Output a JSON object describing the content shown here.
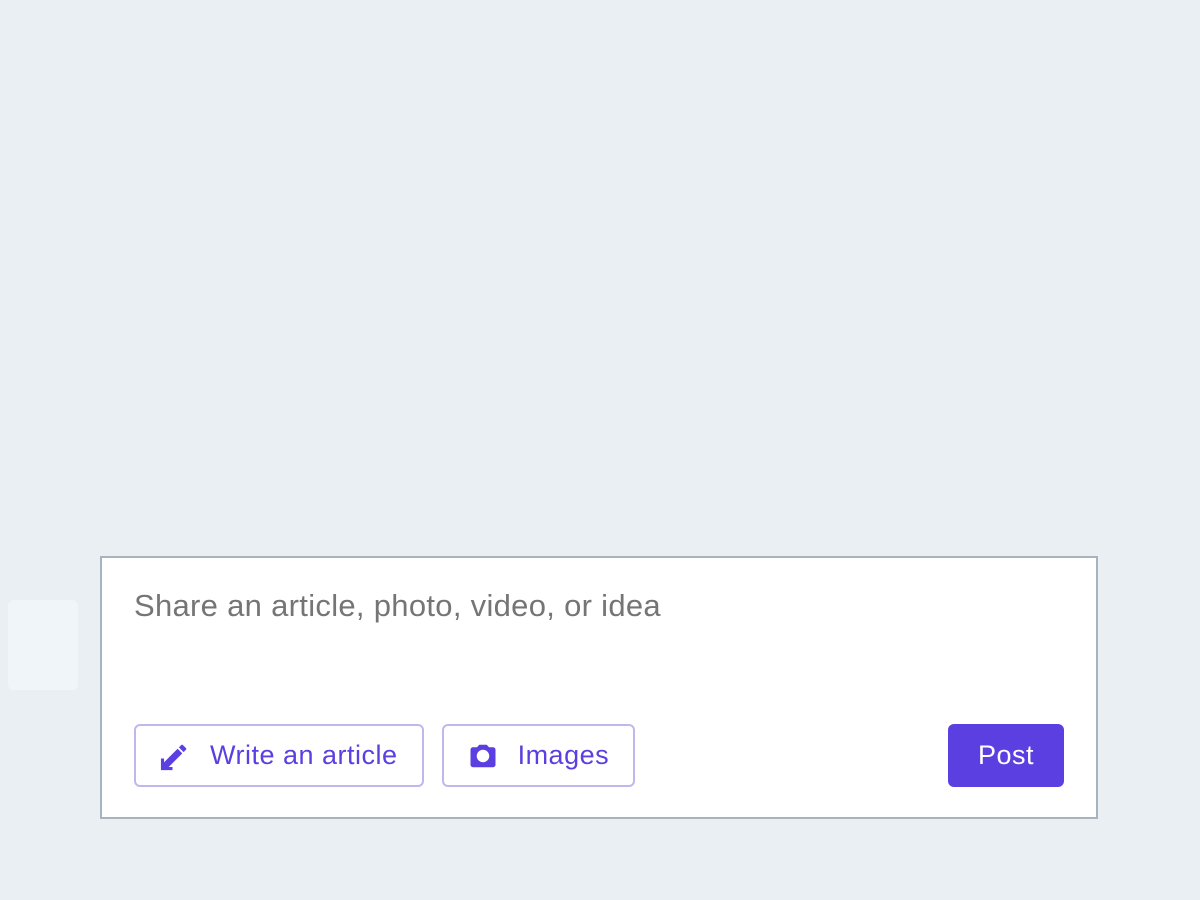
{
  "composer": {
    "placeholder": "Share an article, photo, video, or idea",
    "actions": {
      "write_article_label": "Write an article",
      "images_label": "Images",
      "post_label": "Post"
    }
  }
}
